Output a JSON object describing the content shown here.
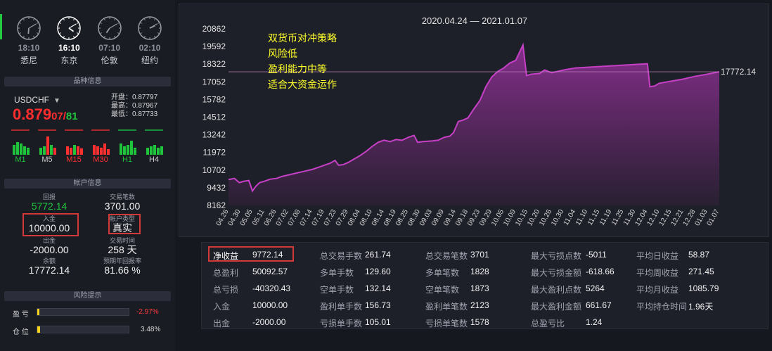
{
  "clocks": [
    {
      "time": "18:10",
      "city": "悉尼",
      "active": false,
      "h": 6,
      "m": 10
    },
    {
      "time": "16:10",
      "city": "东京",
      "active": true,
      "h": 4,
      "m": 10
    },
    {
      "time": "07:10",
      "city": "伦敦",
      "active": false,
      "h": 7,
      "m": 10
    },
    {
      "time": "02:10",
      "city": "纽约",
      "active": false,
      "h": 2,
      "m": 10
    }
  ],
  "sections": {
    "instrument": "品种信息",
    "account": "帐户信息",
    "risk": "风险提示"
  },
  "instrument": {
    "symbol": "USDCHF",
    "price_big": "0.879",
    "price_bid": "07",
    "price_ask": "81",
    "open": "开盘：0.87797",
    "high": "最高：0.87967",
    "low": "最低：0.87733",
    "timeframes": [
      "M1",
      "M5",
      "M15",
      "M30",
      "H1",
      "H4"
    ]
  },
  "account": {
    "return_label": "回报",
    "return_value": "5772.14",
    "trades_label": "交易笔数",
    "trades_value": "3701.00",
    "deposit_label": "入金",
    "deposit_value": "10000.00",
    "type_label": "帐户类型",
    "type_value": "真实",
    "withdraw_label": "出金",
    "withdraw_value": "-2000.00",
    "time_label": "交易时间",
    "time_value": "258 天",
    "balance_label": "余额",
    "balance_value": "17772.14",
    "annual_label": "预期年回报率",
    "annual_value": "81.66 %"
  },
  "risk": {
    "pl_label": "盈 亏",
    "pl_value": "-2.97%",
    "pl_fill": 0.02,
    "pos_label": "仓 位",
    "pos_value": "3.48%",
    "pos_fill": 0.03,
    "accent": "#f6d41a"
  },
  "chart_data": {
    "type": "area",
    "title": "2020.04.24 — 2021.01.07",
    "annotations": [
      "双货币对冲策略",
      "风险低",
      "盈利能力中等",
      "适合大资金运作"
    ],
    "last_value_label": "17772.14",
    "last_value": 17772.14,
    "yticks": [
      8162,
      9432,
      10702,
      11972,
      13242,
      14512,
      15782,
      17052,
      18322,
      19592,
      20862
    ],
    "ylim": [
      8162,
      20862
    ],
    "xticks": [
      "04.26",
      "04.30",
      "05.05",
      "05.11",
      "06.26",
      "07.02",
      "07.08",
      "07.14",
      "07.19",
      "07.23",
      "07.29",
      "08.04",
      "08.10",
      "08.14",
      "08.19",
      "08.25",
      "08.30",
      "09.03",
      "09.09",
      "09.14",
      "09.18",
      "09.23",
      "09.29",
      "10.05",
      "10.09",
      "10.15",
      "10.20",
      "10.26",
      "10.30",
      "11.04",
      "11.10",
      "11.15",
      "11.19",
      "11.25",
      "11.30",
      "12.04",
      "12.10",
      "12.15",
      "12.21",
      "12.28",
      "01.03",
      "01.07"
    ],
    "series": [
      {
        "values": [
          [
            0,
            10020
          ],
          [
            0.5,
            10100
          ],
          [
            0.9,
            9800
          ],
          [
            1.3,
            9900
          ],
          [
            1.7,
            9950
          ],
          [
            2.0,
            9200
          ],
          [
            2.3,
            9550
          ],
          [
            2.6,
            9800
          ],
          [
            3.0,
            9900
          ],
          [
            3.5,
            10050
          ],
          [
            4.0,
            10100
          ],
          [
            4.5,
            10250
          ],
          [
            5.0,
            10350
          ],
          [
            5.5,
            10450
          ],
          [
            6.0,
            10550
          ],
          [
            6.5,
            10650
          ],
          [
            7.0,
            10750
          ],
          [
            7.5,
            10900
          ],
          [
            8.0,
            11050
          ],
          [
            8.5,
            11200
          ],
          [
            8.9,
            11400
          ],
          [
            9.2,
            11050
          ],
          [
            9.6,
            11100
          ],
          [
            10.0,
            11250
          ],
          [
            10.5,
            11500
          ],
          [
            11.0,
            11750
          ],
          [
            11.5,
            12050
          ],
          [
            12.0,
            12400
          ],
          [
            12.5,
            12700
          ],
          [
            13.0,
            12850
          ],
          [
            13.5,
            12750
          ],
          [
            14.0,
            12900
          ],
          [
            14.5,
            12850
          ],
          [
            15.0,
            13050
          ],
          [
            15.5,
            13200
          ],
          [
            15.8,
            12700
          ],
          [
            16.2,
            12750
          ],
          [
            17.0,
            12800
          ],
          [
            17.5,
            12850
          ],
          [
            18.0,
            13050
          ],
          [
            18.5,
            13150
          ],
          [
            18.8,
            13400
          ],
          [
            19.2,
            14200
          ],
          [
            19.6,
            14300
          ],
          [
            20.0,
            14450
          ],
          [
            20.5,
            15100
          ],
          [
            21.0,
            15700
          ],
          [
            21.5,
            16700
          ],
          [
            22.0,
            17400
          ],
          [
            22.5,
            17800
          ],
          [
            23.0,
            18050
          ],
          [
            23.5,
            18400
          ],
          [
            24.0,
            18600
          ],
          [
            24.6,
            19700
          ],
          [
            24.9,
            17500
          ],
          [
            25.3,
            17600
          ],
          [
            26.0,
            17650
          ],
          [
            26.4,
            17900
          ],
          [
            27.0,
            17700
          ],
          [
            27.5,
            17800
          ],
          [
            28.0,
            17900
          ],
          [
            29.0,
            18050
          ],
          [
            30.0,
            18100
          ],
          [
            31.0,
            18150
          ],
          [
            32.0,
            18200
          ],
          [
            33.0,
            18250
          ],
          [
            34.0,
            18300
          ],
          [
            35.0,
            18350
          ],
          [
            35.2,
            16700
          ],
          [
            35.6,
            16750
          ],
          [
            36.0,
            16950
          ],
          [
            37.0,
            17100
          ],
          [
            38.0,
            17250
          ],
          [
            39.0,
            17450
          ],
          [
            40.0,
            17600
          ],
          [
            41.0,
            17772.14
          ]
        ]
      }
    ]
  },
  "stats": [
    [
      [
        "净收益",
        "9772.14"
      ],
      [
        "总盈利",
        "50092.57"
      ],
      [
        "总亏损",
        "-40320.43"
      ],
      [
        "入金",
        "10000.00"
      ],
      [
        "出金",
        "-2000.00"
      ]
    ],
    [
      [
        "总交易手数",
        "261.74"
      ],
      [
        "多单手数",
        "129.60"
      ],
      [
        "空单手数",
        "132.14"
      ],
      [
        "盈利单手数",
        "156.73"
      ],
      [
        "亏损单手数",
        "105.01"
      ]
    ],
    [
      [
        "总交易笔数",
        "3701"
      ],
      [
        "多单笔数",
        "1828"
      ],
      [
        "空单笔数",
        "1873"
      ],
      [
        "盈利单笔数",
        "2123"
      ],
      [
        "亏损单笔数",
        "1578"
      ]
    ],
    [
      [
        "最大亏损点数",
        "-5011"
      ],
      [
        "最大亏损金额",
        "-618.66"
      ],
      [
        "最大盈利点数",
        "5264"
      ],
      [
        "最大盈利金额",
        "661.67"
      ],
      [
        "总盈亏比",
        "1.24"
      ]
    ],
    [
      [
        "平均日收益",
        "58.87"
      ],
      [
        "平均周收益",
        "271.45"
      ],
      [
        "平均月收益",
        "1085.79"
      ],
      [
        "平均持仓时间",
        "1.96天"
      ]
    ]
  ]
}
